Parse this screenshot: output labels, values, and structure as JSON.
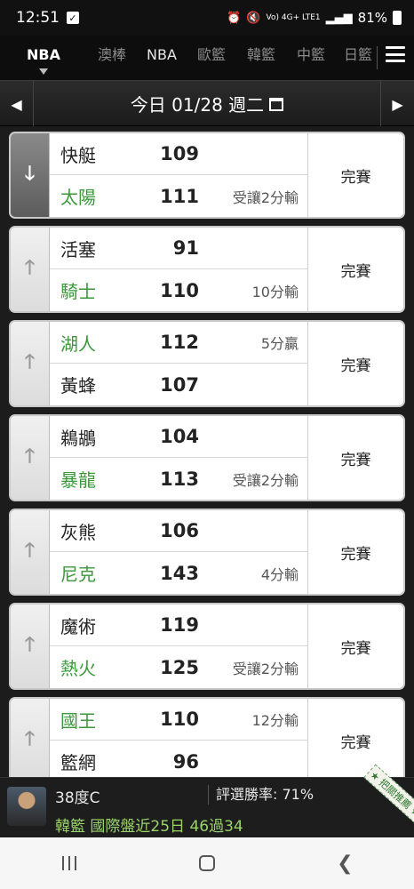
{
  "status_bar": {
    "time": "12:51",
    "signal_text": "Vo) 4G+ LTE1",
    "battery": "81%"
  },
  "league_tabs": [
    {
      "label": "NBA",
      "active": true
    },
    {
      "label": "澳棒",
      "active": false
    },
    {
      "label": "NBA",
      "active": false
    },
    {
      "label": "歐籃",
      "active": false
    },
    {
      "label": "韓籃",
      "active": false
    },
    {
      "label": "中籃",
      "active": false
    },
    {
      "label": "日籃",
      "active": false
    }
  ],
  "date_bar": {
    "label": "今日 01/28 週二",
    "prev_icon": "left-arrow-icon",
    "next_icon": "right-arrow-icon"
  },
  "games": [
    {
      "expanded": true,
      "team1": {
        "name": "快艇",
        "score": "109",
        "note": "",
        "highlight": false
      },
      "team2": {
        "name": "太陽",
        "score": "111",
        "note": "受讓2分輸",
        "highlight": true
      },
      "status": "完賽"
    },
    {
      "expanded": false,
      "team1": {
        "name": "活塞",
        "score": "91",
        "note": "",
        "highlight": false
      },
      "team2": {
        "name": "騎士",
        "score": "110",
        "note": "10分輸",
        "highlight": true
      },
      "status": "完賽"
    },
    {
      "expanded": false,
      "team1": {
        "name": "湖人",
        "score": "112",
        "note": "5分贏",
        "highlight": true
      },
      "team2": {
        "name": "黃蜂",
        "score": "107",
        "note": "",
        "highlight": false
      },
      "status": "完賽"
    },
    {
      "expanded": false,
      "team1": {
        "name": "鵜鶘",
        "score": "104",
        "note": "",
        "highlight": false
      },
      "team2": {
        "name": "暴龍",
        "score": "113",
        "note": "受讓2分輸",
        "highlight": true
      },
      "status": "完賽"
    },
    {
      "expanded": false,
      "team1": {
        "name": "灰熊",
        "score": "106",
        "note": "",
        "highlight": false
      },
      "team2": {
        "name": "尼克",
        "score": "143",
        "note": "4分輸",
        "highlight": true
      },
      "status": "完賽"
    },
    {
      "expanded": false,
      "team1": {
        "name": "魔術",
        "score": "119",
        "note": "",
        "highlight": false
      },
      "team2": {
        "name": "熱火",
        "score": "125",
        "note": "受讓2分輸",
        "highlight": true
      },
      "status": "完賽"
    },
    {
      "expanded": false,
      "team1": {
        "name": "國王",
        "score": "110",
        "note": "12分輸",
        "highlight": true
      },
      "team2": {
        "name": "籃網",
        "score": "96",
        "note": "",
        "highlight": false
      },
      "status": "完賽"
    }
  ],
  "info_bar": {
    "expert_name": "38度C",
    "win_rate": "評選勝率: 71%",
    "record": "韓籃 國際盤近25日 46過34",
    "ribbon": "★ 把關推薦 ★"
  },
  "colors": {
    "highlight_team": "#3a9a3a",
    "background": "#1c1c1c"
  }
}
